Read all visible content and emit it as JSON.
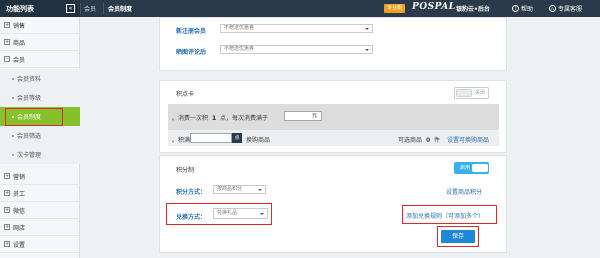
{
  "topbar": {
    "title": "功能列表",
    "collapse_icon": "«",
    "breadcrumb_home": "会员",
    "breadcrumb_current": "会员制度",
    "badge": "专业版",
    "logo": "POSPAL",
    "logo_cn": "银豹云•后台",
    "help_label": "帮助",
    "support_label": "专属客服"
  },
  "sidebar": {
    "items": [
      {
        "label": "销售",
        "icon": "plus-icon"
      },
      {
        "label": "商品",
        "icon": "plus-icon"
      },
      {
        "label": "会员",
        "icon": "minus-icon"
      }
    ],
    "sub_items": [
      {
        "label": "会员资料"
      },
      {
        "label": "会员等级"
      },
      {
        "label": "会员制度"
      },
      {
        "label": "会员筛选"
      },
      {
        "label": "次卡管理"
      }
    ],
    "bottom_items": [
      {
        "label": "营销",
        "icon": "plus-icon"
      },
      {
        "label": "员工",
        "icon": "plus-icon"
      },
      {
        "label": "微信",
        "icon": "plus-icon"
      },
      {
        "label": "网店",
        "icon": "plus-icon"
      },
      {
        "label": "设置",
        "icon": "plus-icon"
      }
    ]
  },
  "coupons": {
    "new_member_label": "新注册会员",
    "new_member_value": "不赠送优惠券",
    "review_label": "晒图评论后",
    "review_value": "不赠送优惠券"
  },
  "points_card": {
    "title": "积点卡",
    "toggle_label": "关闭",
    "rule_prefix": "。消费一次积",
    "rule_points": "1",
    "rule_mid": "点，每次消费满于",
    "rule_unit": "元",
    "exchange_prefix": "。积满",
    "exchange_suffix": "换购商品",
    "selectable_prefix": "可选商品",
    "selectable_count": "0",
    "selectable_unit": "件",
    "set_goods_link": "设置可换购商品"
  },
  "points_system": {
    "title": "积分制",
    "toggle_label": "启用",
    "method_label": "积分方式：",
    "method_value": "按商品积分",
    "set_points_link": "设置商品积分",
    "redeem_label": "兑换方式：",
    "redeem_value": "兑换礼品",
    "add_rule_link": "添加兑换规则（可添加多个）",
    "save_label": "保存"
  },
  "colors": {
    "topbar": "#2b3a4a",
    "active_nav": "#84c12b",
    "highlight": "#e0282e",
    "accent_blue": "#1f88d6",
    "toggle_on": "#3cb0e8"
  }
}
